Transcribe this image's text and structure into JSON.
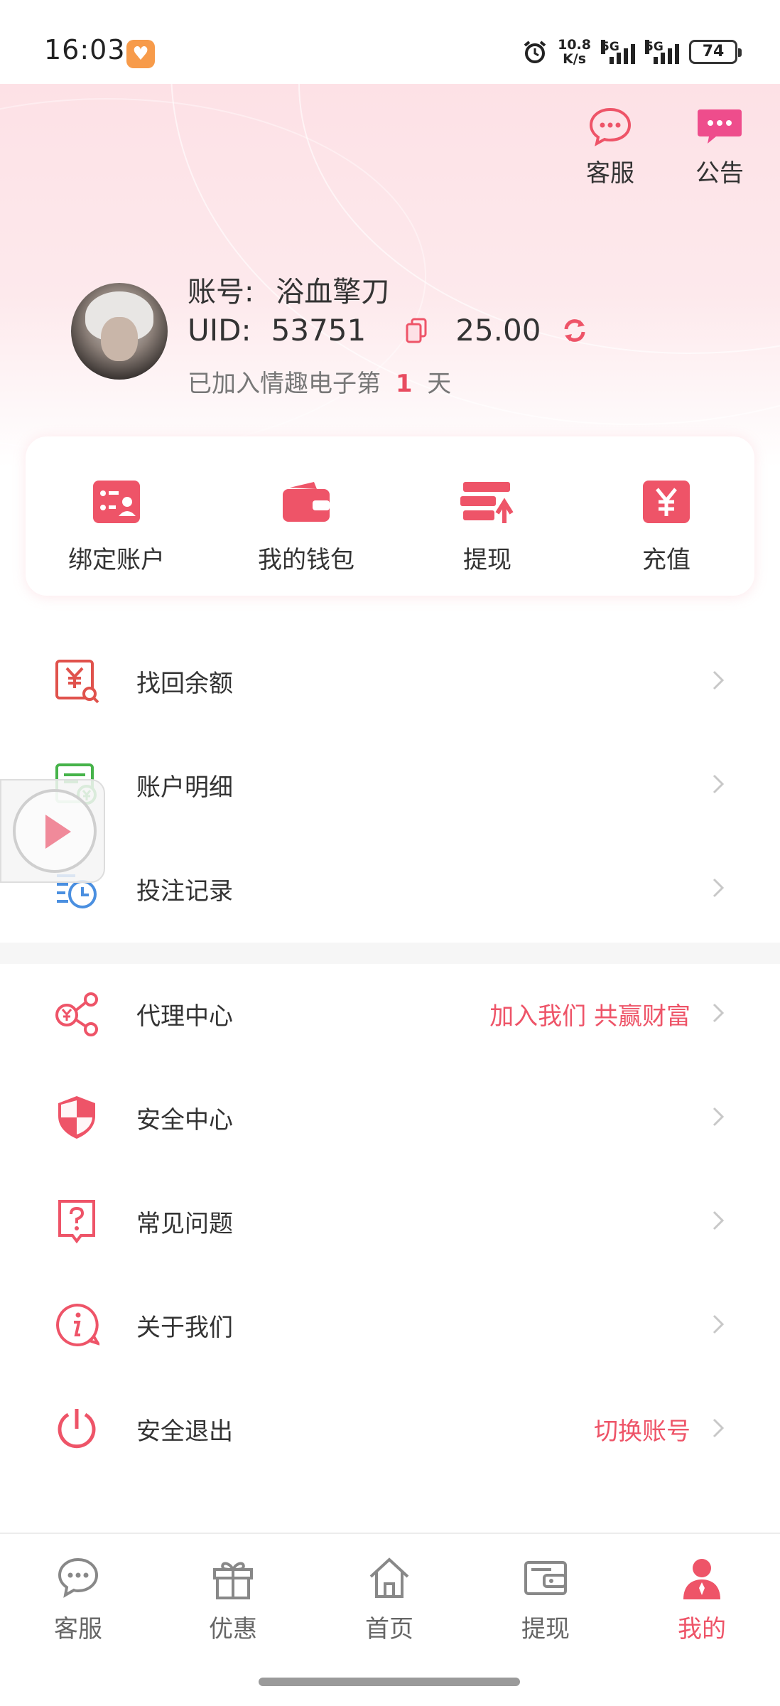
{
  "status_bar": {
    "time": "16:03",
    "net_speed_value": "10.8",
    "net_speed_unit": "K/s",
    "sim1": "5G",
    "sim2": "5G",
    "battery": "74"
  },
  "colors": {
    "accent": "#ee5468",
    "header_pink": "#fde1e6",
    "text": "#333333",
    "muted": "#777777"
  },
  "top_actions": [
    {
      "label": "客服",
      "icon": "chat-bubble-icon"
    },
    {
      "label": "公告",
      "icon": "announcement-icon"
    }
  ],
  "profile": {
    "account_label": "账号:",
    "account_name": "浴血擎刀",
    "uid_label": "UID:",
    "uid_value": "53751",
    "balance": "25.00",
    "join_prefix": "已加入情趣电子第",
    "join_days": "1",
    "join_suffix": "天"
  },
  "quick_actions": [
    {
      "label": "绑定账户",
      "icon": "bind-account-icon"
    },
    {
      "label": "我的钱包",
      "icon": "wallet-icon"
    },
    {
      "label": "提现",
      "icon": "withdraw-icon"
    },
    {
      "label": "充值",
      "icon": "recharge-yuan-icon"
    }
  ],
  "menu_group1": [
    {
      "label": "找回余额",
      "icon": "recover-balance-icon",
      "extra": ""
    },
    {
      "label": "账户明细",
      "icon": "account-details-icon",
      "extra": ""
    },
    {
      "label": "投注记录",
      "icon": "bet-record-icon",
      "extra": ""
    }
  ],
  "menu_group2": [
    {
      "label": "代理中心",
      "icon": "agent-center-icon",
      "extra": "加入我们 共赢财富"
    },
    {
      "label": "安全中心",
      "icon": "shield-icon",
      "extra": ""
    },
    {
      "label": "常见问题",
      "icon": "faq-icon",
      "extra": ""
    },
    {
      "label": "关于我们",
      "icon": "info-icon",
      "extra": ""
    },
    {
      "label": "安全退出",
      "icon": "power-icon",
      "extra": "切换账号"
    }
  ],
  "tabbar": [
    {
      "label": "客服",
      "icon": "chat-bubble-icon",
      "active": false
    },
    {
      "label": "优惠",
      "icon": "gift-icon",
      "active": false
    },
    {
      "label": "首页",
      "icon": "home-icon",
      "active": false
    },
    {
      "label": "提现",
      "icon": "wallet-card-icon",
      "active": false
    },
    {
      "label": "我的",
      "icon": "user-icon",
      "active": true
    }
  ]
}
